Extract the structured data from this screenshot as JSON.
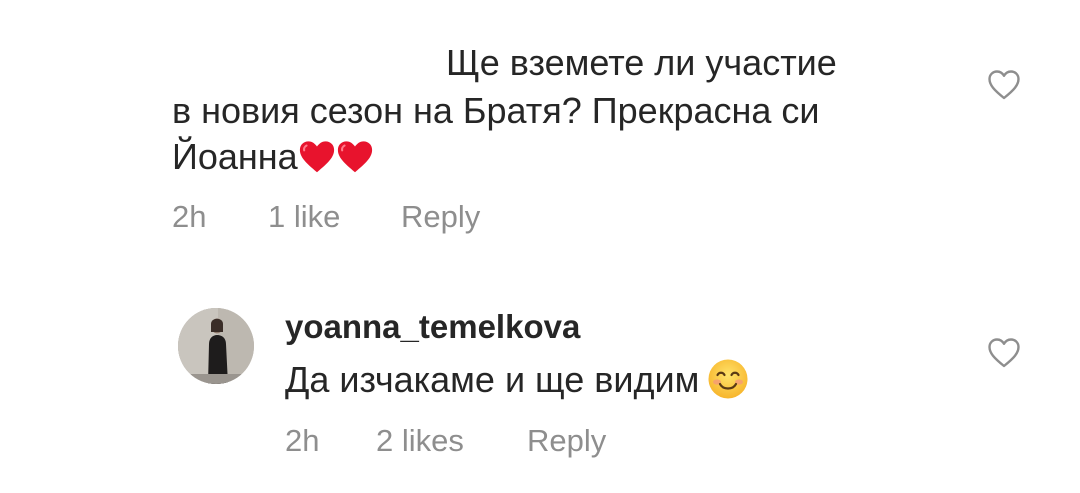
{
  "comment": {
    "line1": "Ще вземете ли участие",
    "line2": "в новия сезон на Братя? Прекрасна си",
    "line3": "Йоанна",
    "line3_emoji": "heart-emoji",
    "time": "2h",
    "likes": "1 like",
    "reply": "Reply",
    "like_icon": "heart-outline-icon"
  },
  "reply": {
    "username": "yoanna_temelkova",
    "text": "Да изчакаме и ще видим",
    "emoji": "smiling-face-emoji",
    "time": "2h",
    "likes": "2 likes",
    "reply": "Reply",
    "like_icon": "heart-outline-icon"
  },
  "colors": {
    "text": "#262626",
    "meta": "#8e8e8e",
    "heart_red": "#e8132d"
  }
}
